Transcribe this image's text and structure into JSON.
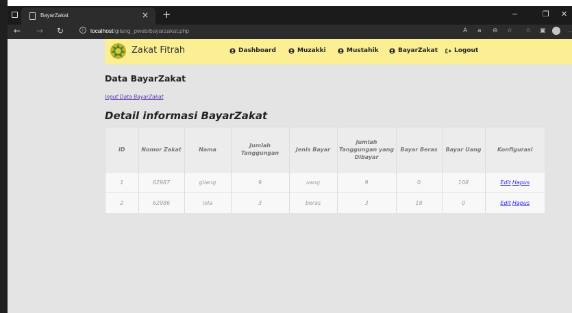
{
  "browser": {
    "tab_title": "BayarZakat",
    "tab_close": "×",
    "new_tab": "+",
    "url_host": "localhost",
    "url_path": "/gilang_pweb/bayarzakat.php",
    "min": "−",
    "restore": "❐",
    "close": "✕"
  },
  "navbar": {
    "brand": "Zakat Fitrah",
    "items": [
      {
        "label": "Dashboard",
        "icon": "user-circle-icon"
      },
      {
        "label": "Muzakki",
        "icon": "user-circle-icon"
      },
      {
        "label": "Mustahik",
        "icon": "user-circle-icon"
      },
      {
        "label": "BayarZakat",
        "icon": "user-circle-icon"
      },
      {
        "label": "Logout",
        "icon": "sign-out-icon"
      }
    ]
  },
  "page": {
    "title": "Data BayarZakat",
    "input_link": "Input Data BayarZakat",
    "section_title": "Detail informasi BayarZakat"
  },
  "table": {
    "headers": [
      "ID",
      "Nomor Zakat",
      "Nama",
      "Jumlah Tanggungan",
      "Jenis Bayar",
      "Jumlah Tanggungan yang Dibayar",
      "Bayar Beras",
      "Bayar Uang",
      "Konfigurasi"
    ],
    "rows": [
      [
        "1",
        "62987",
        "gilang",
        "9",
        "uang",
        "9",
        "0",
        "108"
      ],
      [
        "2",
        "62986",
        "lola",
        "3",
        "beras",
        "3",
        "18",
        "0"
      ]
    ],
    "edit_label": "Edit",
    "delete_label": "Hapus"
  },
  "colors": {
    "navbar_bg": "#fbee93",
    "page_bg": "#e4e4e4",
    "link": "#2a2aee"
  }
}
